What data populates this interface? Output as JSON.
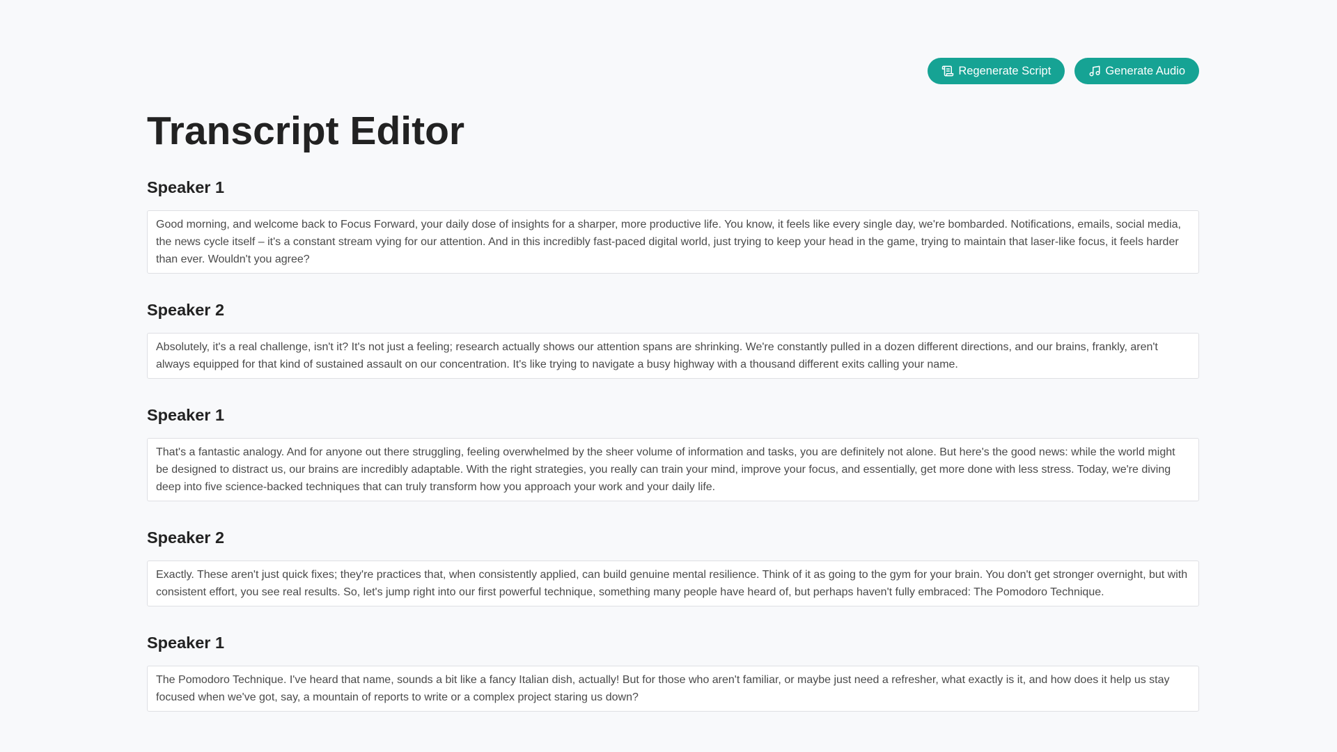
{
  "toolbar": {
    "regenerate_label": "Regenerate Script",
    "regenerate_icon": "scroll-icon",
    "generate_audio_label": "Generate Audio",
    "generate_audio_icon": "music-note-icon",
    "button_color": "#16a394"
  },
  "page": {
    "title": "Transcript Editor"
  },
  "entries": [
    {
      "speaker": "Speaker 1",
      "text": "Good morning, and welcome back to Focus Forward, your daily dose of insights for a sharper, more productive life. You know, it feels like every single day, we're bombarded. Notifications, emails, social media, the news cycle itself – it's a constant stream vying for our attention. And in this incredibly fast-paced digital world, just trying to keep your head in the game, trying to maintain that laser-like focus, it feels harder than ever. Wouldn't you agree?"
    },
    {
      "speaker": "Speaker 2",
      "text": "Absolutely, it's a real challenge, isn't it? It's not just a feeling; research actually shows our attention spans are shrinking. We're constantly pulled in a dozen different directions, and our brains, frankly, aren't always equipped for that kind of sustained assault on our concentration. It's like trying to navigate a busy highway with a thousand different exits calling your name."
    },
    {
      "speaker": "Speaker 1",
      "text": "That's a fantastic analogy. And for anyone out there struggling, feeling overwhelmed by the sheer volume of information and tasks, you are definitely not alone. But here's the good news: while the world might be designed to distract us, our brains are incredibly adaptable. With the right strategies, you really can train your mind, improve your focus, and essentially, get more done with less stress. Today, we're diving deep into five science-backed techniques that can truly transform how you approach your work and your daily life."
    },
    {
      "speaker": "Speaker 2",
      "text": "Exactly. These aren't just quick fixes; they're practices that, when consistently applied, can build genuine mental resilience. Think of it as going to the gym for your brain. You don't get stronger overnight, but with consistent effort, you see real results. So, let's jump right into our first powerful technique, something many people have heard of, but perhaps haven't fully embraced: The Pomodoro Technique."
    },
    {
      "speaker": "Speaker 1",
      "text": "The Pomodoro Technique. I've heard that name, sounds a bit like a fancy Italian dish, actually! But for those who aren't familiar, or maybe just need a refresher, what exactly is it, and how does it help us stay focused when we've got, say, a mountain of reports to write or a complex project staring us down?"
    }
  ]
}
